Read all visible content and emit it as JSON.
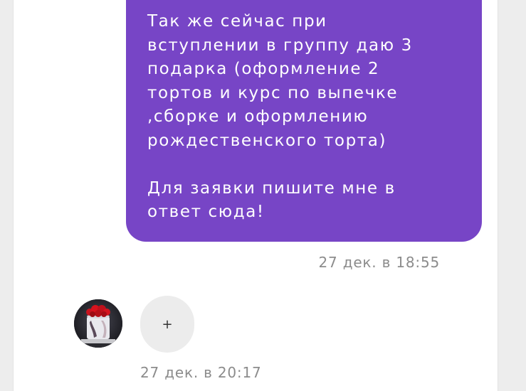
{
  "messages": [
    {
      "direction": "outgoing",
      "text": "Так же сейчас при\nвступлении в группу даю 3\nподарка (оформление 2\nтортов и курс по выпечке\n,сборке и оформлению\nрождественского торта)\n\nДля заявки пишите мне в\nответ сюда!",
      "timestamp": "27 дек. в 18:55"
    },
    {
      "direction": "incoming",
      "text": "+",
      "timestamp": "27 дек. в 20:17"
    }
  ],
  "colors": {
    "outgoing_bubble": "#7745c6",
    "incoming_bubble": "#ececec",
    "timestamp": "#8c8c8c"
  }
}
